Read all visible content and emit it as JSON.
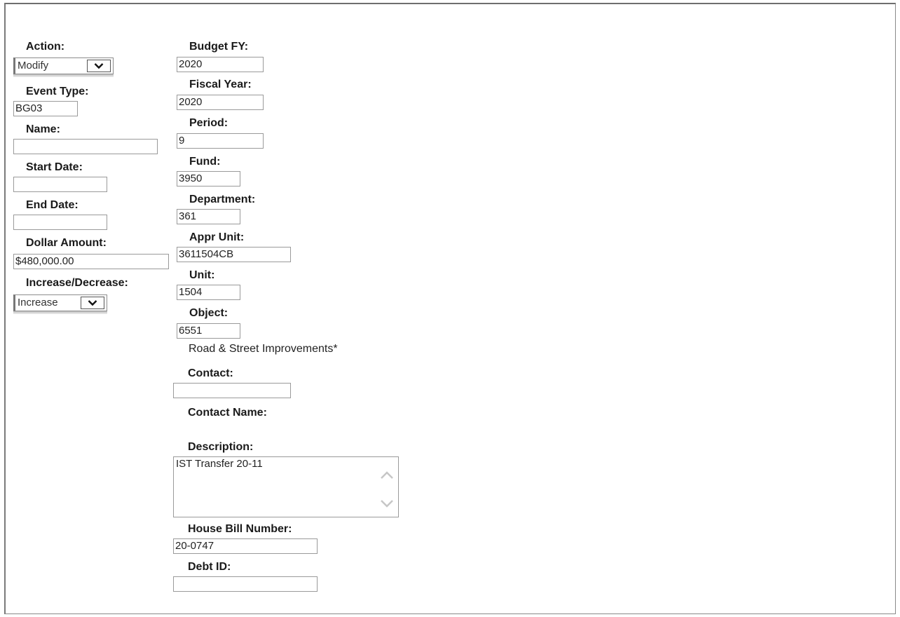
{
  "form": {
    "action": {
      "label": "Action:",
      "value": "Modify"
    },
    "event_type": {
      "label": "Event Type:",
      "value": "BG03"
    },
    "name": {
      "label": "Name:",
      "value": ""
    },
    "start_date": {
      "label": "Start Date:",
      "value": ""
    },
    "end_date": {
      "label": "End Date:",
      "value": ""
    },
    "dollar_amount": {
      "label": "Dollar Amount:",
      "value": "$480,000.00"
    },
    "increase_decrease": {
      "label": "Increase/Decrease:",
      "value": "Increase"
    },
    "budget_fy": {
      "label": "Budget FY:",
      "value": "2020"
    },
    "fiscal_year": {
      "label": "Fiscal Year:",
      "value": "2020"
    },
    "period": {
      "label": "Period:",
      "value": "9"
    },
    "fund": {
      "label": "Fund:",
      "value": "3950"
    },
    "department": {
      "label": "Department:",
      "value": "361"
    },
    "appr_unit": {
      "label": "Appr Unit:",
      "value": "3611504CB"
    },
    "unit": {
      "label": "Unit:",
      "value": "1504"
    },
    "object": {
      "label": "Object:",
      "value": "6551",
      "description": "Road & Street Improvements*"
    },
    "contact": {
      "label": "Contact:",
      "value": ""
    },
    "contact_name": {
      "label": "Contact Name:"
    },
    "description": {
      "label": "Description:",
      "value": "IST Transfer 20-11"
    },
    "house_bill_number": {
      "label": "House Bill Number:",
      "value": "20-0747"
    },
    "debt_id": {
      "label": "Debt ID:",
      "value": ""
    }
  },
  "icons": {
    "dropdown": "chevron-down-icon",
    "scroll_up": "scroll-up-icon",
    "scroll_down": "scroll-down-icon"
  }
}
